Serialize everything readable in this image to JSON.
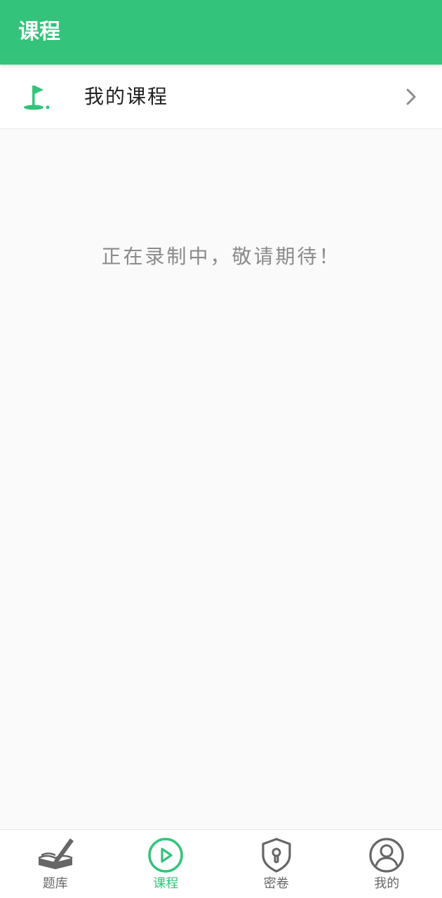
{
  "header": {
    "title": "课程"
  },
  "course_row": {
    "label": "我的课程",
    "icon": "flag-icon"
  },
  "empty_state": {
    "message": "正在录制中，敬请期待！"
  },
  "bottom_nav": {
    "items": [
      {
        "label": "题库",
        "icon": "book-pen-icon",
        "active": false
      },
      {
        "label": "课程",
        "icon": "play-circle-icon",
        "active": true
      },
      {
        "label": "密卷",
        "icon": "shield-lock-icon",
        "active": false
      },
      {
        "label": "我的",
        "icon": "user-circle-icon",
        "active": false
      }
    ]
  },
  "colors": {
    "brand": "#33c37b",
    "background": "#fafafa",
    "text_primary": "#222222",
    "text_muted": "#8a8a8a"
  }
}
